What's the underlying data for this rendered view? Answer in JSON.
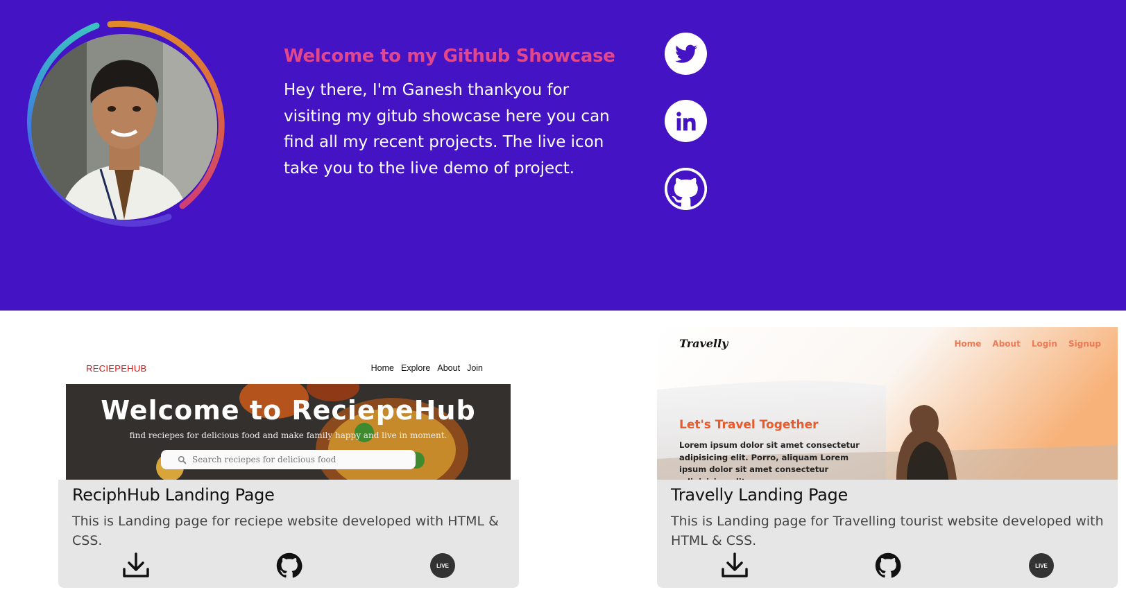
{
  "intro": {
    "title": "Welcome to my Github Showcase",
    "text": "Hey there, I'm Ganesh thankyou for visiting my gitub showcase here you can find all my recent projects. The live icon take you to the live demo of project."
  },
  "social": [
    "twitter-icon",
    "linkedin-icon",
    "github-icon"
  ],
  "colors": {
    "hero_bg": "#4413c4",
    "intro_title": "#e0478c",
    "card_bg": "#e6e6e6"
  },
  "projects": [
    {
      "title": "ReciphHub Landing Page",
      "description": "This is Landing page for reciepe website developed with HTML & CSS.",
      "live_label": "LIVE",
      "preview": {
        "brand": "RECIEPEHUB",
        "nav": [
          "Home",
          "Explore",
          "About",
          "Join"
        ],
        "banner_title": "Welcome to ReciepeHub",
        "banner_subtitle": "find reciepes for delicious food and make family happy and live in moment.",
        "search_placeholder": "Search reciepes for delicious food"
      }
    },
    {
      "title": "Travelly Landing Page",
      "description": "This is Landing page for Travelling tourist website developed with HTML & CSS.",
      "live_label": "LIVE",
      "preview": {
        "brand": "Travelly",
        "nav": [
          "Home",
          "About",
          "Login",
          "Signup"
        ],
        "headline": "Let's Travel Together",
        "body": "Lorem ipsum dolor sit amet consectetur adipisicing elit. Porro, aliquam Lorem ipsum dolor sit amet consectetur adipisicing elit"
      }
    }
  ]
}
